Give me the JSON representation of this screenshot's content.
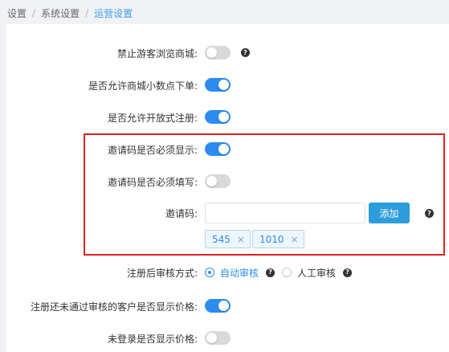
{
  "breadcrumb": {
    "items": [
      "设置",
      "系统设置",
      "运营设置"
    ]
  },
  "settings": {
    "guest_browse": {
      "label": "禁止游客浏览商城:",
      "on": false
    },
    "decimal_order": {
      "label": "是否允许商城小数点下单:",
      "on": true
    },
    "open_register": {
      "label": "是否允许开放式注册:",
      "on": true
    },
    "invite_show": {
      "label": "邀请码是否必须显示:",
      "on": true
    },
    "invite_required": {
      "label": "邀请码是否必须填写:",
      "on": false
    },
    "invite_code": {
      "label": "邀请码:",
      "value": "",
      "placeholder": "",
      "add_label": "添加",
      "tags": [
        "545",
        "1010"
      ],
      "tag_remove_glyph": "×"
    },
    "review_mode": {
      "label": "注册后审核方式:",
      "options": [
        "自动审核",
        "人工审核"
      ],
      "selected": "自动审核"
    },
    "unapproved_price": {
      "label": "注册还未通过审核的客户是否显示价格:",
      "on": true
    },
    "guest_price": {
      "label": "未登录是否显示价格:",
      "on": false
    }
  },
  "help_glyph": "?",
  "colors": {
    "accent": "#2d8cf0",
    "highlight_border": "#e02020",
    "add_button": "#2d9cdb"
  }
}
